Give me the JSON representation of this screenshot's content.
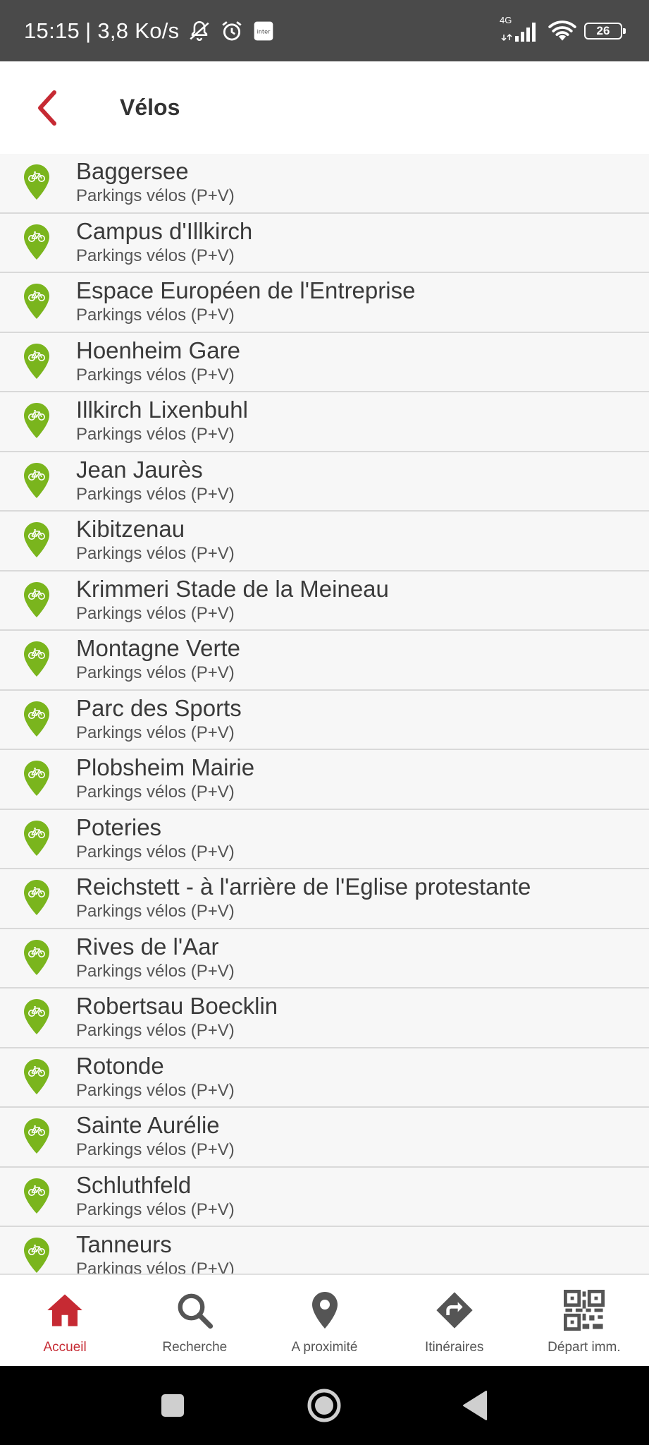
{
  "status_bar": {
    "time": "15:15",
    "speed": "| 3,8 Ko/s",
    "network": "4G",
    "battery": "26",
    "icons": [
      "bell-off-icon",
      "alarm-icon",
      "inter-app-icon",
      "signal-icon",
      "wifi-icon",
      "battery-icon"
    ]
  },
  "header": {
    "title": "Vélos",
    "back_icon": "chevron-left-icon",
    "accent_color": "#c62a33"
  },
  "list": {
    "pin_color": "#7ab51d",
    "pin_icon": "bicycle-pin-icon",
    "items": [
      {
        "name": "Baggersee",
        "type": "Parkings vélos (P+V)"
      },
      {
        "name": "Campus d'Illkirch",
        "type": "Parkings vélos (P+V)"
      },
      {
        "name": "Espace Européen de l'Entreprise",
        "type": "Parkings vélos (P+V)"
      },
      {
        "name": "Hoenheim Gare",
        "type": "Parkings vélos (P+V)"
      },
      {
        "name": "Illkirch Lixenbuhl",
        "type": "Parkings vélos (P+V)"
      },
      {
        "name": "Jean Jaurès",
        "type": "Parkings vélos (P+V)"
      },
      {
        "name": "Kibitzenau",
        "type": "Parkings vélos (P+V)"
      },
      {
        "name": "Krimmeri Stade de la Meineau",
        "type": "Parkings vélos (P+V)"
      },
      {
        "name": "Montagne Verte",
        "type": "Parkings vélos (P+V)"
      },
      {
        "name": "Parc des Sports",
        "type": "Parkings vélos (P+V)"
      },
      {
        "name": "Plobsheim Mairie",
        "type": "Parkings vélos (P+V)"
      },
      {
        "name": "Poteries",
        "type": "Parkings vélos (P+V)"
      },
      {
        "name": "Reichstett - à l'arrière de l'Eglise protestante",
        "type": "Parkings vélos (P+V)"
      },
      {
        "name": "Rives de l'Aar",
        "type": "Parkings vélos (P+V)"
      },
      {
        "name": "Robertsau Boecklin",
        "type": "Parkings vélos (P+V)"
      },
      {
        "name": "Rotonde",
        "type": "Parkings vélos (P+V)"
      },
      {
        "name": "Sainte Aurélie",
        "type": "Parkings vélos (P+V)"
      },
      {
        "name": "Schluthfeld",
        "type": "Parkings vélos (P+V)"
      },
      {
        "name": "Tanneurs",
        "type": "Parkings vélos (P+V)"
      }
    ]
  },
  "bottom_nav": {
    "items": [
      {
        "label": "Accueil",
        "icon": "home-icon",
        "active": true
      },
      {
        "label": "Recherche",
        "icon": "search-icon",
        "active": false
      },
      {
        "label": "A proximité",
        "icon": "location-pin-icon",
        "active": false
      },
      {
        "label": "Itinéraires",
        "icon": "directions-icon",
        "active": false
      },
      {
        "label": "Départ imm.",
        "icon": "qr-code-icon",
        "active": false
      }
    ]
  },
  "system_nav": {
    "buttons": [
      "recents-button",
      "home-button",
      "back-button"
    ]
  }
}
